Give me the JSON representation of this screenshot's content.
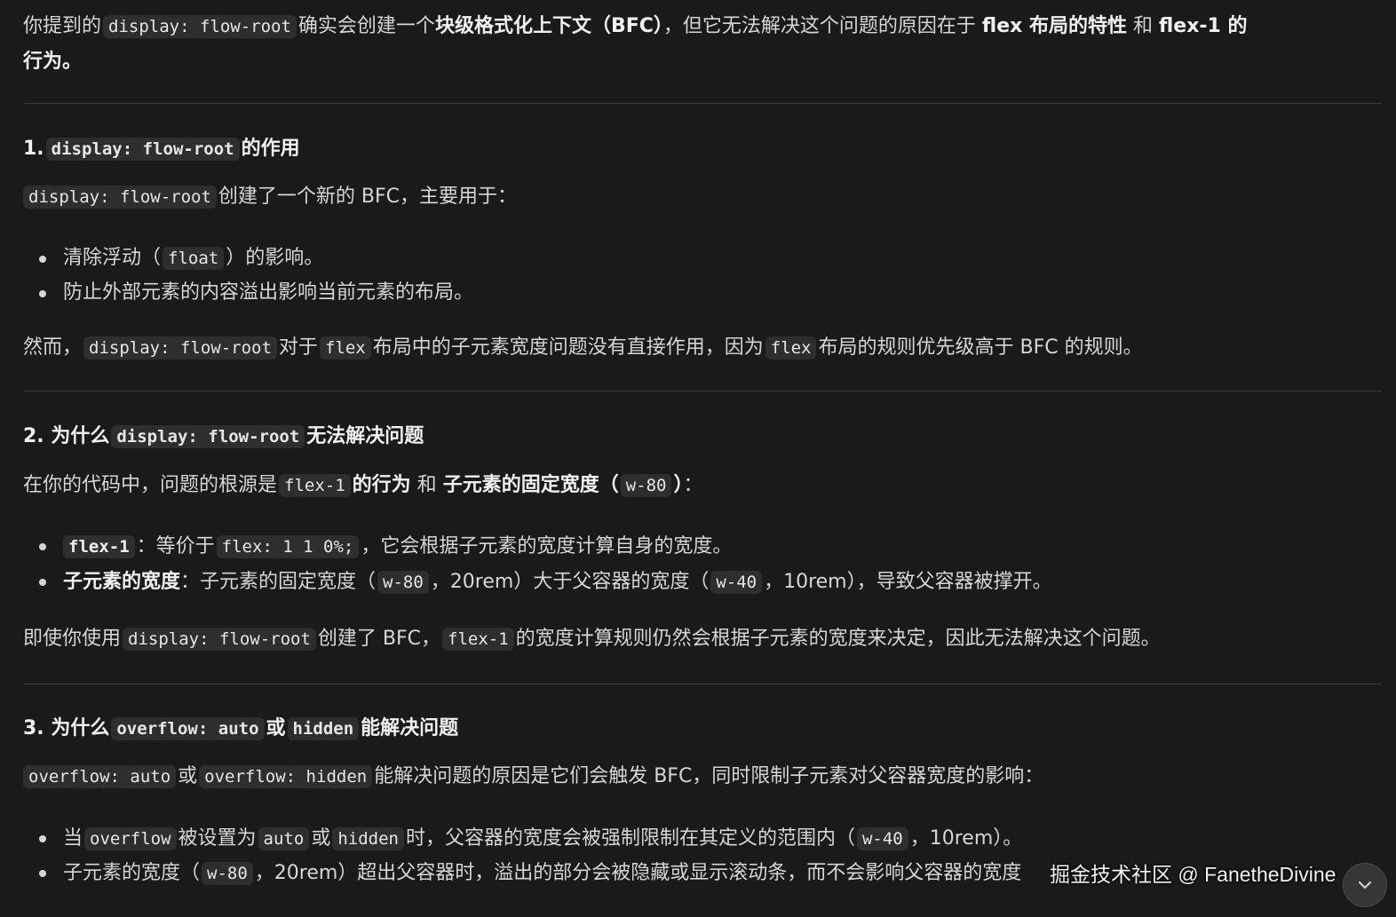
{
  "intro": {
    "t1": "你提到的",
    "c1": "display: flow-root",
    "t2": "确实会创建一个",
    "b1": "块级格式化上下文（BFC）",
    "t3": "，但它无法解决这个问题的原因在于",
    "b2": "flex 布局的特性",
    "t4": "和",
    "b3": "flex-1 的",
    "b4": "行为。"
  },
  "section1": {
    "num": "1.",
    "code": "display: flow-root",
    "title_rest": "的作用",
    "p1_code": "display: flow-root",
    "p1_text": "创建了一个新的 BFC，主要用于：",
    "li1_a": "清除浮动（",
    "li1_code": "float",
    "li1_b": "）的影响。",
    "li2": "防止外部元素的内容溢出影响当前元素的布局。",
    "p2_a": "然而，",
    "p2_code1": "display: flow-root",
    "p2_b": "对于",
    "p2_code2": "flex",
    "p2_c": "布局中的子元素宽度问题没有直接作用，因为",
    "p2_code3": "flex",
    "p2_d": "布局的规则优先级高于 BFC 的规则。"
  },
  "section2": {
    "num": "2.",
    "title_a": "为什么",
    "code": "display: flow-root",
    "title_b": "无法解决问题",
    "p1_a": "在你的代码中，问题的根源是",
    "p1_code1": "flex-1",
    "p1_b1": "的行为",
    "p1_b": "和",
    "p1_b2": "子元素的固定宽度（",
    "p1_code2": "w-80",
    "p1_b3": "）",
    "p1_c": "：",
    "li1_code1": "flex-1",
    "li1_a": "：等价于",
    "li1_code2": "flex: 1 1 0%;",
    "li1_b": "，它会根据子元素的宽度计算自身的宽度。",
    "li2_bold": "子元素的宽度",
    "li2_a": "：子元素的固定宽度（",
    "li2_code1": "w-80",
    "li2_b": "，20rem）大于父容器的宽度（",
    "li2_code2": "w-40",
    "li2_c": "，10rem），导致父容器被撑开。",
    "p2_a": "即使你使用",
    "p2_code1": "display: flow-root",
    "p2_b": "创建了 BFC，",
    "p2_code2": "flex-1",
    "p2_c": "的宽度计算规则仍然会根据子元素的宽度来决定，因此无法解决这个问题。"
  },
  "section3": {
    "num": "3.",
    "title_a": "为什么",
    "code1": "overflow: auto",
    "title_b": "或",
    "code2": "hidden",
    "title_c": "能解决问题",
    "p1_code1": "overflow: auto",
    "p1_a": "或",
    "p1_code2": "overflow: hidden",
    "p1_b": "能解决问题的原因是它们会触发 BFC，同时限制子元素对父容器宽度的影响：",
    "li1_a": "当",
    "li1_code1": "overflow",
    "li1_b": "被设置为",
    "li1_code2": "auto",
    "li1_c": "或",
    "li1_code3": "hidden",
    "li1_d": "时，父容器的宽度会被强制限制在其定义的范围内（",
    "li1_code4": "w-40",
    "li1_e": "，10rem）。",
    "li2_a": "子元素的宽度（",
    "li2_code": "w-80",
    "li2_b": "，20rem）超出父容器时，溢出的部分会被隐藏或显示滚动条，而不会影响父容器的宽度"
  },
  "watermark": "掘金技术社区 @ FanetheDivine",
  "scroll_button_icon": "chevron-down-icon"
}
